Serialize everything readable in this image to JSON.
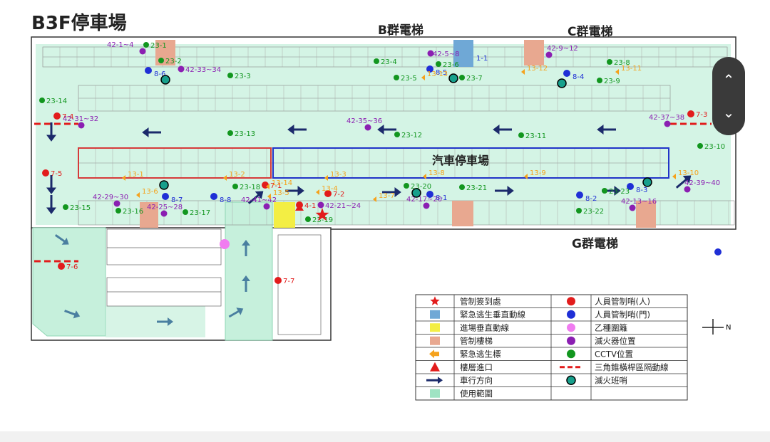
{
  "title": "B3F停車場",
  "elevators": {
    "b": "B群電梯",
    "c": "C群電梯",
    "g": "G群電梯"
  },
  "zone_label": "汽車停車場",
  "compass": "N",
  "colors": {
    "green_area": "#c6f0dc",
    "red_marker": "#e21c1c",
    "blue_marker": "#1f2fd6",
    "pink_marker": "#f07cf0",
    "purple_marker": "#8b1fb2",
    "green_marker": "#12961f",
    "orange_marker": "#f5a21c",
    "teal_marker": "#17a08c",
    "arrow": "#1b2a6b",
    "salmon_stair": "#e8a890",
    "blue_stair": "#6fa8d6",
    "yellow_stair": "#f3ee44"
  },
  "markers": {
    "red": [
      "7-4",
      "7-5",
      "7-1",
      "7-2",
      "7-3",
      "7-6",
      "7-7",
      "4-1"
    ],
    "blue": [
      "8-6",
      "8-5",
      "8-4",
      "8-7",
      "8-8",
      "8-1",
      "8-2",
      "8-3"
    ],
    "purple": [
      "42-1~4",
      "42-33~34",
      "42-5~8",
      "42-9~12",
      "42-31~32",
      "42-35~36",
      "42-37~38",
      "42-29~30",
      "42-25~28",
      "42-41~42",
      "42-21~24",
      "42-17~20",
      "42-13~16",
      "42-39~40"
    ],
    "green": [
      "23-1",
      "23-2",
      "23-3",
      "23-4",
      "23-5",
      "23-6",
      "23-7",
      "23-8",
      "23-9",
      "23-10",
      "23-11",
      "23-12",
      "23-13",
      "23-14",
      "23-15",
      "23-16",
      "23-17",
      "23-18",
      "23-19",
      "23-20",
      "23-21",
      "23-22",
      "23-23"
    ],
    "orange": [
      "13-1",
      "13-2",
      "13-3",
      "13-4",
      "13-5",
      "13-6",
      "13-7",
      "13-8",
      "13-9",
      "13-10",
      "13-11",
      "13-12",
      "13-13",
      "13-14"
    ],
    "door_label": "1-1"
  },
  "legend": [
    {
      "symbol": "star",
      "label": "管制簽到處"
    },
    {
      "symbol": "blue-box",
      "label": "緊急逃生垂直動線"
    },
    {
      "symbol": "yellow-box",
      "label": "進場垂直動線"
    },
    {
      "symbol": "salmon-box",
      "label": "管制樓梯"
    },
    {
      "symbol": "orange-arrow",
      "label": "緊急逃生標"
    },
    {
      "symbol": "red-triangle",
      "label": "樓層進口"
    },
    {
      "symbol": "navy-arrow",
      "label": "車行方向"
    },
    {
      "symbol": "green-box",
      "label": "使用範圍"
    },
    {
      "symbol": "red-dot",
      "label": "人員管制哨(人)"
    },
    {
      "symbol": "blue-dot",
      "label": "人員管制哨(門)"
    },
    {
      "symbol": "pink-dot",
      "label": "乙種圍籬"
    },
    {
      "symbol": "purple-dot",
      "label": "滅火器位置"
    },
    {
      "symbol": "green-dot",
      "label": "CCTV位置"
    },
    {
      "symbol": "dash",
      "label": "三角錐橫桿區隔動線"
    },
    {
      "symbol": "teal-ring",
      "label": "滅火班哨"
    }
  ],
  "scroll": {
    "up_icon": "chevron-up-icon",
    "down_icon": "chevron-down-icon"
  }
}
